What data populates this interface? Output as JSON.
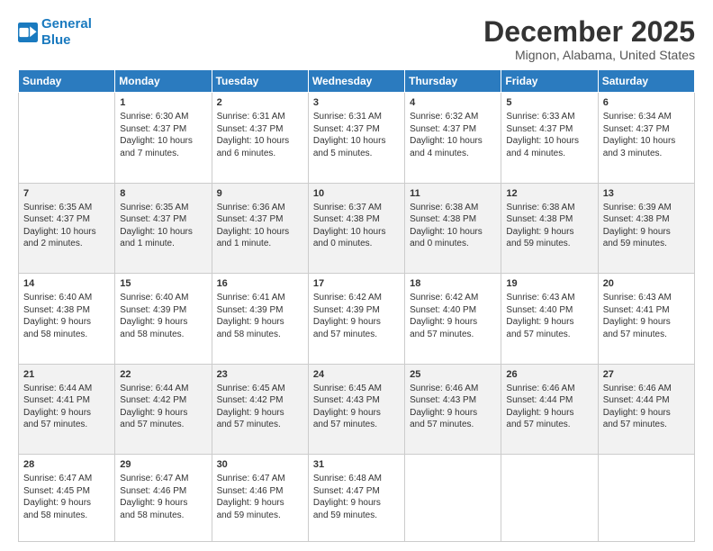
{
  "logo": {
    "line1": "General",
    "line2": "Blue"
  },
  "title": "December 2025",
  "subtitle": "Mignon, Alabama, United States",
  "days": [
    "Sunday",
    "Monday",
    "Tuesday",
    "Wednesday",
    "Thursday",
    "Friday",
    "Saturday"
  ],
  "weeks": [
    [
      {
        "num": "",
        "text": ""
      },
      {
        "num": "1",
        "text": "Sunrise: 6:30 AM\nSunset: 4:37 PM\nDaylight: 10 hours\nand 7 minutes."
      },
      {
        "num": "2",
        "text": "Sunrise: 6:31 AM\nSunset: 4:37 PM\nDaylight: 10 hours\nand 6 minutes."
      },
      {
        "num": "3",
        "text": "Sunrise: 6:31 AM\nSunset: 4:37 PM\nDaylight: 10 hours\nand 5 minutes."
      },
      {
        "num": "4",
        "text": "Sunrise: 6:32 AM\nSunset: 4:37 PM\nDaylight: 10 hours\nand 4 minutes."
      },
      {
        "num": "5",
        "text": "Sunrise: 6:33 AM\nSunset: 4:37 PM\nDaylight: 10 hours\nand 4 minutes."
      },
      {
        "num": "6",
        "text": "Sunrise: 6:34 AM\nSunset: 4:37 PM\nDaylight: 10 hours\nand 3 minutes."
      }
    ],
    [
      {
        "num": "7",
        "text": "Sunrise: 6:35 AM\nSunset: 4:37 PM\nDaylight: 10 hours\nand 2 minutes."
      },
      {
        "num": "8",
        "text": "Sunrise: 6:35 AM\nSunset: 4:37 PM\nDaylight: 10 hours\nand 1 minute."
      },
      {
        "num": "9",
        "text": "Sunrise: 6:36 AM\nSunset: 4:37 PM\nDaylight: 10 hours\nand 1 minute."
      },
      {
        "num": "10",
        "text": "Sunrise: 6:37 AM\nSunset: 4:38 PM\nDaylight: 10 hours\nand 0 minutes."
      },
      {
        "num": "11",
        "text": "Sunrise: 6:38 AM\nSunset: 4:38 PM\nDaylight: 10 hours\nand 0 minutes."
      },
      {
        "num": "12",
        "text": "Sunrise: 6:38 AM\nSunset: 4:38 PM\nDaylight: 9 hours\nand 59 minutes."
      },
      {
        "num": "13",
        "text": "Sunrise: 6:39 AM\nSunset: 4:38 PM\nDaylight: 9 hours\nand 59 minutes."
      }
    ],
    [
      {
        "num": "14",
        "text": "Sunrise: 6:40 AM\nSunset: 4:38 PM\nDaylight: 9 hours\nand 58 minutes."
      },
      {
        "num": "15",
        "text": "Sunrise: 6:40 AM\nSunset: 4:39 PM\nDaylight: 9 hours\nand 58 minutes."
      },
      {
        "num": "16",
        "text": "Sunrise: 6:41 AM\nSunset: 4:39 PM\nDaylight: 9 hours\nand 58 minutes."
      },
      {
        "num": "17",
        "text": "Sunrise: 6:42 AM\nSunset: 4:39 PM\nDaylight: 9 hours\nand 57 minutes."
      },
      {
        "num": "18",
        "text": "Sunrise: 6:42 AM\nSunset: 4:40 PM\nDaylight: 9 hours\nand 57 minutes."
      },
      {
        "num": "19",
        "text": "Sunrise: 6:43 AM\nSunset: 4:40 PM\nDaylight: 9 hours\nand 57 minutes."
      },
      {
        "num": "20",
        "text": "Sunrise: 6:43 AM\nSunset: 4:41 PM\nDaylight: 9 hours\nand 57 minutes."
      }
    ],
    [
      {
        "num": "21",
        "text": "Sunrise: 6:44 AM\nSunset: 4:41 PM\nDaylight: 9 hours\nand 57 minutes."
      },
      {
        "num": "22",
        "text": "Sunrise: 6:44 AM\nSunset: 4:42 PM\nDaylight: 9 hours\nand 57 minutes."
      },
      {
        "num": "23",
        "text": "Sunrise: 6:45 AM\nSunset: 4:42 PM\nDaylight: 9 hours\nand 57 minutes."
      },
      {
        "num": "24",
        "text": "Sunrise: 6:45 AM\nSunset: 4:43 PM\nDaylight: 9 hours\nand 57 minutes."
      },
      {
        "num": "25",
        "text": "Sunrise: 6:46 AM\nSunset: 4:43 PM\nDaylight: 9 hours\nand 57 minutes."
      },
      {
        "num": "26",
        "text": "Sunrise: 6:46 AM\nSunset: 4:44 PM\nDaylight: 9 hours\nand 57 minutes."
      },
      {
        "num": "27",
        "text": "Sunrise: 6:46 AM\nSunset: 4:44 PM\nDaylight: 9 hours\nand 57 minutes."
      }
    ],
    [
      {
        "num": "28",
        "text": "Sunrise: 6:47 AM\nSunset: 4:45 PM\nDaylight: 9 hours\nand 58 minutes."
      },
      {
        "num": "29",
        "text": "Sunrise: 6:47 AM\nSunset: 4:46 PM\nDaylight: 9 hours\nand 58 minutes."
      },
      {
        "num": "30",
        "text": "Sunrise: 6:47 AM\nSunset: 4:46 PM\nDaylight: 9 hours\nand 59 minutes."
      },
      {
        "num": "31",
        "text": "Sunrise: 6:48 AM\nSunset: 4:47 PM\nDaylight: 9 hours\nand 59 minutes."
      },
      {
        "num": "",
        "text": ""
      },
      {
        "num": "",
        "text": ""
      },
      {
        "num": "",
        "text": ""
      }
    ]
  ]
}
